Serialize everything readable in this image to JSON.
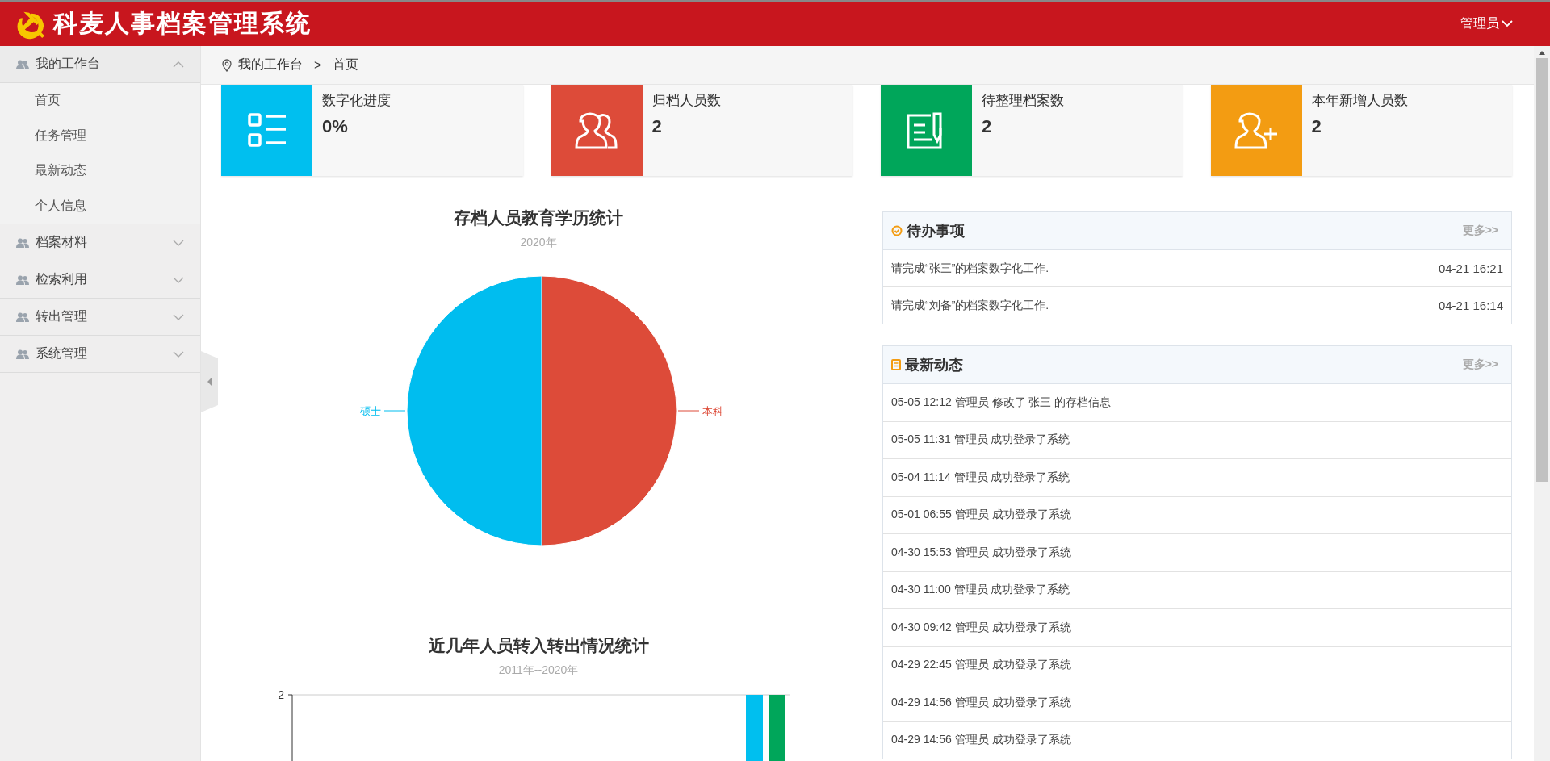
{
  "header": {
    "title": "科麦人事档案管理系统",
    "user": "管理员"
  },
  "sidebar": {
    "groups": [
      {
        "label": "我的工作台",
        "expanded": true,
        "children": [
          {
            "label": "首页"
          },
          {
            "label": "任务管理"
          },
          {
            "label": "最新动态"
          },
          {
            "label": "个人信息"
          }
        ]
      },
      {
        "label": "档案材料",
        "expanded": false
      },
      {
        "label": "检索利用",
        "expanded": false
      },
      {
        "label": "转出管理",
        "expanded": false
      },
      {
        "label": "系统管理",
        "expanded": false
      }
    ]
  },
  "breadcrumb": {
    "items": [
      "我的工作台",
      "首页"
    ],
    "separator": ">"
  },
  "stat_cards": [
    {
      "kind": "progress",
      "label": "数字化进度",
      "value": "0%",
      "color": "#00bfef"
    },
    {
      "kind": "people",
      "label": "归档人员数",
      "value": "2",
      "color": "#dd4b39"
    },
    {
      "kind": "document",
      "label": "待整理档案数",
      "value": "2",
      "color": "#00a65a"
    },
    {
      "kind": "new_user",
      "label": "本年新增人员数",
      "value": "2",
      "color": "#f39c12"
    }
  ],
  "education_chart": {
    "title": "存档人员教育学历统计",
    "subtitle": "2020年",
    "chart_data": {
      "type": "pie",
      "categories": [
        "本科",
        "硕士"
      ],
      "values": [
        50,
        50
      ]
    }
  },
  "transfer_chart": {
    "title": "近几年人员转入转出情况统计",
    "subtitle": "2011年--2020年",
    "y_tick_label": "2"
  },
  "todo": {
    "title": "待办事项",
    "more": "更多>>",
    "items": [
      {
        "text": "请完成“张三”的档案数字化工作.",
        "time": "04-21 16:21"
      },
      {
        "text": "请完成“刘备”的档案数字化工作.",
        "time": "04-21 16:14"
      }
    ]
  },
  "activity": {
    "title": "最新动态",
    "more": "更多>>",
    "items": [
      {
        "text": "05-05 12:12 管理员 修改了 张三 的存档信息"
      },
      {
        "text": "05-05 11:31 管理员 成功登录了系统"
      },
      {
        "text": "05-04 11:14 管理员 成功登录了系统"
      },
      {
        "text": "05-01 06:55 管理员 成功登录了系统"
      },
      {
        "text": "04-30 15:53 管理员 成功登录了系统"
      },
      {
        "text": "04-30 11:00 管理员 成功登录了系统"
      },
      {
        "text": "04-30 09:42 管理员 成功登录了系统"
      },
      {
        "text": "04-29 22:45 管理员 成功登录了系统"
      },
      {
        "text": "04-29 14:56 管理员 成功登录了系统"
      },
      {
        "text": "04-29 14:56 管理员 成功登录了系统"
      }
    ]
  }
}
